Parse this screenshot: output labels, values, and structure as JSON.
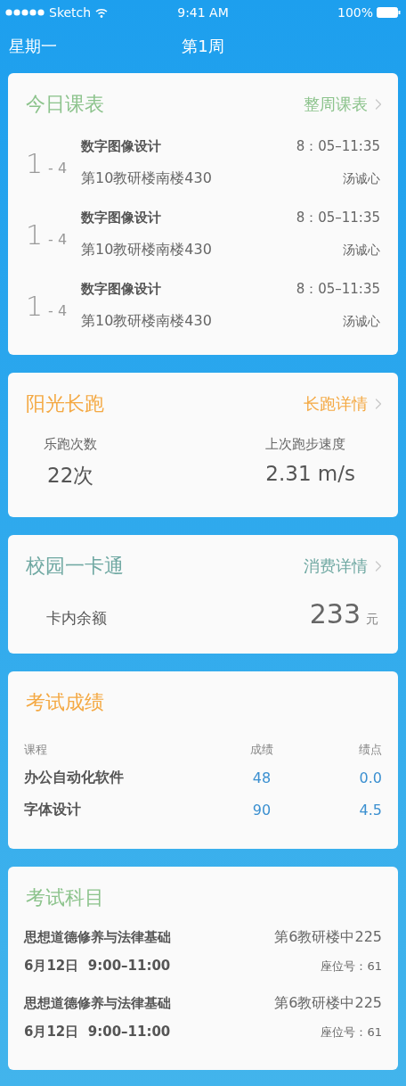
{
  "status_bar": {
    "carrier": "Sketch",
    "time": "9:41 AM",
    "battery": "100%"
  },
  "nav": {
    "day": "星期一",
    "week": "第1周"
  },
  "cards": [
    {
      "kind": "schedule",
      "title": "今日课表",
      "color": "#8cc38c",
      "link": "整周课表",
      "classes": [
        {
          "start": "1",
          "end": "- 4",
          "name": "数字图像设计",
          "time": "8：05–11:35",
          "room": "第10教研楼南楼430",
          "teacher": "汤诚心"
        },
        {
          "start": "1",
          "end": "- 4",
          "name": "数字图像设计",
          "time": "8：05–11:35",
          "room": "第10教研楼南楼430",
          "teacher": "汤诚心"
        },
        {
          "start": "1",
          "end": "- 4",
          "name": "数字图像设计",
          "time": "8：05–11:35",
          "room": "第10教研楼南楼430",
          "teacher": "汤诚心"
        }
      ]
    },
    {
      "kind": "running",
      "title": "阳光长跑",
      "color": "#f4a944",
      "link": "长跑详情",
      "stats": [
        {
          "label": "乐跑次数",
          "value": "22次"
        },
        {
          "label": "上次跑步速度",
          "value": "2.31 m/s"
        }
      ]
    },
    {
      "kind": "balance",
      "title": "校园一卡通",
      "color": "#6fa8a2",
      "link": "消费详情",
      "label": "卡内余额",
      "amount": "233",
      "unit": "元"
    },
    {
      "kind": "grades",
      "title": "考试成绩",
      "color": "#f4a944",
      "columns": [
        "课程",
        "成绩",
        "绩点"
      ],
      "rows": [
        [
          "办公自动化软件",
          "48",
          "0.0"
        ],
        [
          "字体设计",
          "90",
          "4.5"
        ]
      ]
    },
    {
      "kind": "exams",
      "title": "考试科目",
      "color": "#8cc38c",
      "exams": [
        {
          "course": "思想道德修养与法律基础",
          "place": "第6教研楼中225",
          "date": "6月12日  9:00–11:00",
          "seat": "座位号：61"
        },
        {
          "course": "思想道德修养与法律基础",
          "place": "第6教研楼中225",
          "date": "6月12日  9:00–11:00",
          "seat": "座位号：61"
        }
      ]
    }
  ]
}
